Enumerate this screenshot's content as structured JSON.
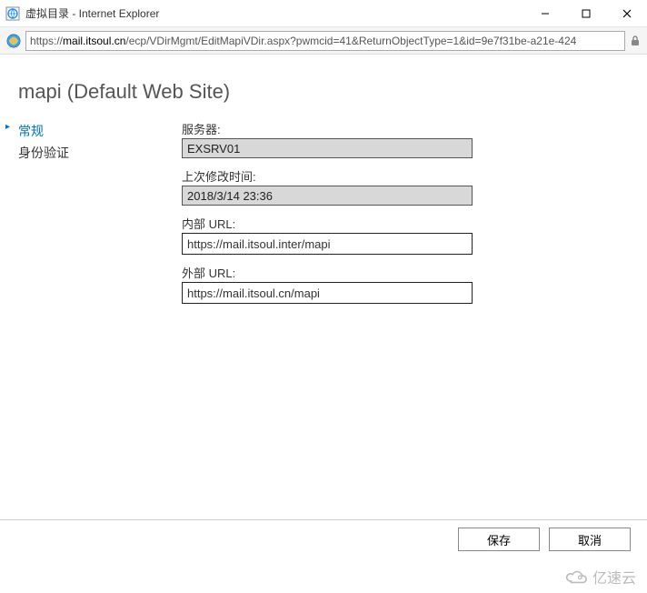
{
  "window": {
    "title": "虚拟目录 - Internet Explorer"
  },
  "address": {
    "prefix": "https://",
    "host": "mail.itsoul.cn",
    "path": "/ecp/VDirMgmt/EditMapiVDir.aspx?pwmcid=41&ReturnObjectType=1&id=9e7f31be-a21e-424"
  },
  "page": {
    "title": "mapi (Default Web Site)"
  },
  "sidebar": {
    "items": [
      {
        "label": "常规",
        "active": true
      },
      {
        "label": "身份验证",
        "active": false
      }
    ]
  },
  "form": {
    "server_label": "服务器:",
    "server_value": "EXSRV01",
    "modified_label": "上次修改时间:",
    "modified_value": "2018/3/14 23:36",
    "internal_label": "内部 URL:",
    "internal_value": "https://mail.itsoul.inter/mapi",
    "external_label": "外部 URL:",
    "external_value": "https://mail.itsoul.cn/mapi"
  },
  "footer": {
    "save_label": "保存",
    "cancel_label": "取消"
  },
  "watermark": {
    "text": "亿速云"
  }
}
